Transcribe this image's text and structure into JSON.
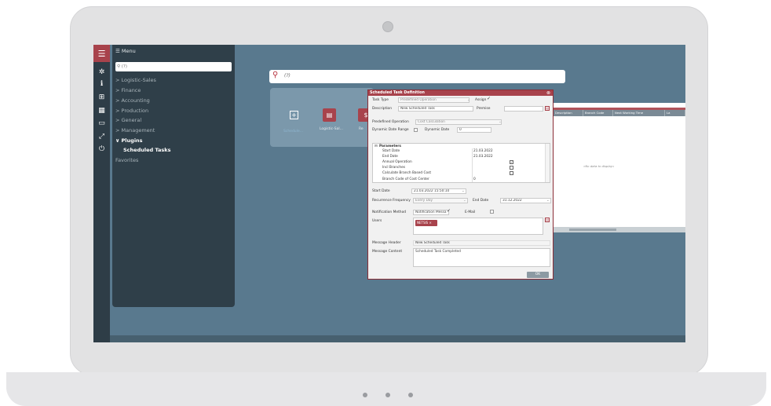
{
  "menu": {
    "header": "Menu",
    "search_text": "(?)",
    "items": [
      "Logistic-Sales",
      "Finance",
      "Accounting",
      "Production",
      "General",
      "Management",
      "Plugins",
      "Scheduled Tasks",
      "Favorites"
    ]
  },
  "search": {
    "text": "(?)"
  },
  "tiles": {
    "add_label": "Schedule…",
    "logistic_label": "Logistic-Sal...",
    "third_label": "Re"
  },
  "grid": {
    "headers": [
      "Description",
      "Branch Code",
      "Next Working Time",
      "La"
    ],
    "empty_text": "«No data to display»"
  },
  "dialog": {
    "title": "Scheduled Task Definition",
    "task_type_label": "Task Type",
    "task_type_value": "Predefined Operation",
    "assign_label": "Assign",
    "description_label": "Description",
    "description_value": "New Scheduled Task",
    "premise_label": "Premise",
    "predefined_op_label": "Predefined Operation",
    "predefined_op_value": "Cost Calculation",
    "dynamic_range_label": "Dynamic Date Range",
    "dynamic_date_label": "Dynamic Date",
    "dynamic_date_value": "0",
    "params_header": "Parameters",
    "params": [
      {
        "name": "Start Date",
        "value": "21.03.2022"
      },
      {
        "name": "End Date",
        "value": "21.03.2022"
      },
      {
        "name": "Annual Operation",
        "value": ""
      },
      {
        "name": "Incl Branches",
        "value": ""
      },
      {
        "name": "Calculate Branch Based Cost",
        "value": ""
      },
      {
        "name": "Branch Code of Cost Center",
        "value": "0"
      }
    ],
    "start_date_label": "Start Date",
    "start_date_value": "21.03.2022 15:50:10",
    "recurrence_label": "Recurrence Frequency",
    "recurrence_value": "Every Day",
    "end_date_label": "End Date",
    "end_date_value": "31.12.2022",
    "notification_label": "Notification Method",
    "notification_value": "Notification Messa",
    "email_label": "E-Mail",
    "users_label": "Users",
    "user_chip": "NETSIS ×",
    "msg_header_label": "Message Header",
    "msg_header_value": "New Scheduled Task",
    "msg_content_label": "Message Content",
    "msg_content_value": "Scheduled Task Completed",
    "ok_label": "OK"
  }
}
